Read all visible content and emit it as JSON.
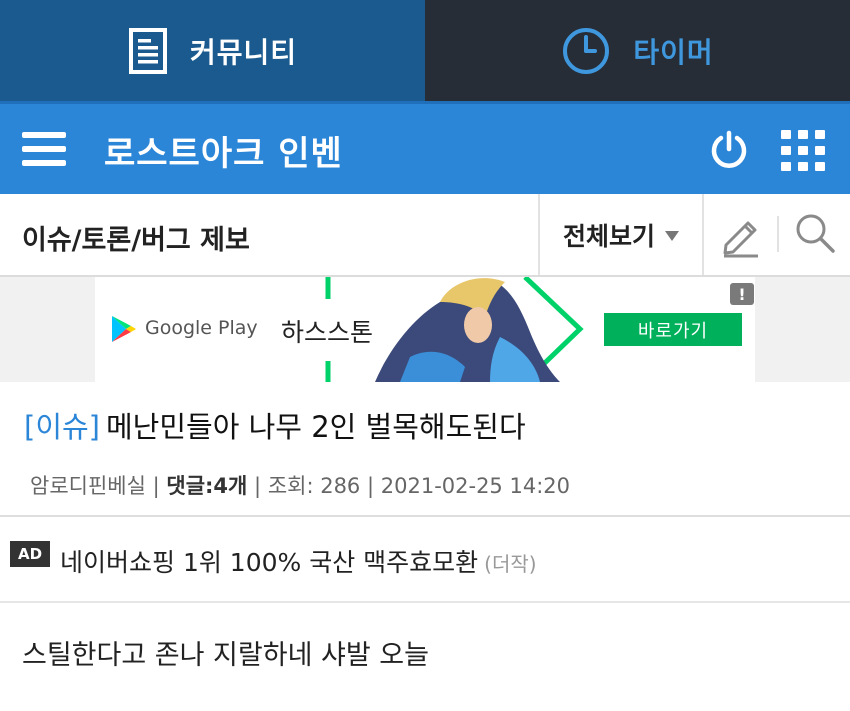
{
  "tabs": [
    {
      "label": "커뮤니티",
      "icon": "document-icon",
      "active": true
    },
    {
      "label": "타이머",
      "icon": "clock-icon",
      "active": false
    }
  ],
  "header": {
    "title": "로스트아크 인벤",
    "menu_icon": "hamburger-menu-icon",
    "power_icon": "power-icon",
    "apps_icon": "grid-apps-icon",
    "color": "#2c86d8"
  },
  "board": {
    "name": "이슈/토론/버그 제보",
    "filter_label": "전체보기",
    "write_icon": "pencil-icon",
    "search_icon": "search-icon"
  },
  "banner": {
    "store_text": "Google Play",
    "game_name": "하스스톤",
    "cta_label": "바로가기",
    "info_label": "!",
    "cta_color": "#00b05a"
  },
  "post": {
    "category": "[이슈]",
    "title": "메난민들아 나무 2인 벌목해도된다",
    "author": "암로디핀베실",
    "comments_label": "댓글:",
    "comments_count": "4개",
    "views": "조회: 286",
    "date": "2021-02-25 14:20",
    "category_color": "#2c86d8"
  },
  "ad_row": {
    "badge": "AD",
    "text": "네이버쇼핑 1위 100% 국산 맥주효모환",
    "source": "(더작)"
  },
  "post2": {
    "title": "스틸한다고 존나 지랄하네 샤발 오늘"
  }
}
